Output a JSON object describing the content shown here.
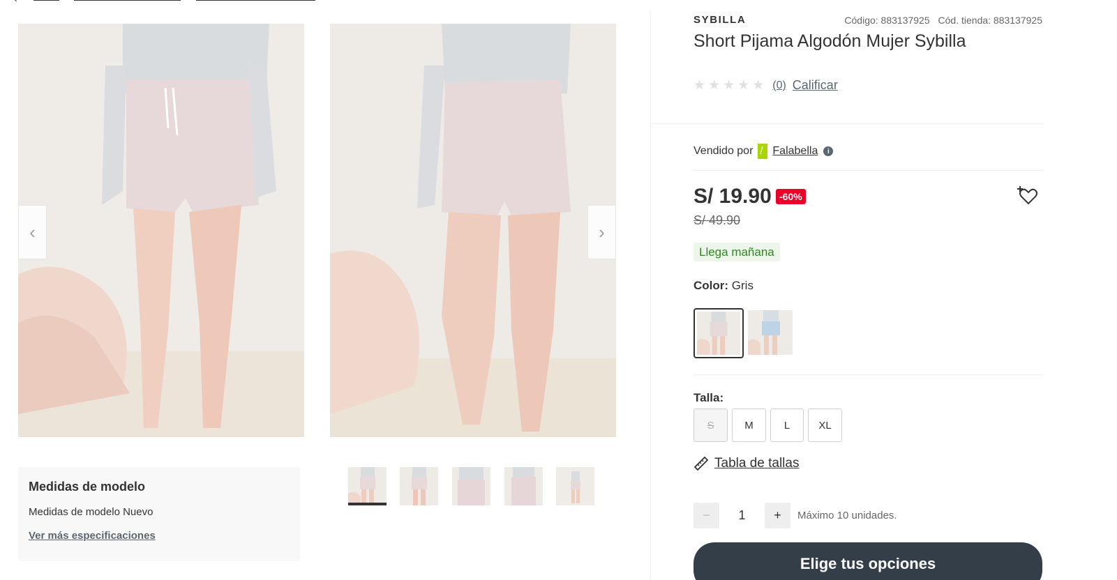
{
  "product": {
    "brand": "SYBILLA",
    "code_label": "Código: 883137925",
    "store_code_label": "Cód. tienda: 883137925",
    "title": "Short Pijama Algodón Mujer Sybilla",
    "rating_count": "(0)",
    "rate_label": "Calificar",
    "stars": 5,
    "rating_value": 0
  },
  "seller": {
    "prefix": "Vendido por",
    "name": "Falabella",
    "info_glyph": "i",
    "logo_color": "#aad500"
  },
  "pricing": {
    "price": "S/ 19.90",
    "discount": "-60%",
    "old_price": "S/ 49.90",
    "discount_color": "#eb0029"
  },
  "delivery": {
    "label": "Llega mañana",
    "color": "#30871f"
  },
  "color": {
    "label": "Color:",
    "value": "Gris",
    "options": [
      "gris",
      "celeste"
    ]
  },
  "size": {
    "label": "Talla:",
    "options": [
      "S",
      "M",
      "L",
      "XL"
    ],
    "disabled": [
      "S"
    ],
    "chart_label": "Tabla de tallas"
  },
  "quantity": {
    "minus": "−",
    "value": "1",
    "plus": "+",
    "limit_label": "Máximo 10 unidades."
  },
  "cta": {
    "label": "Elige tus opciones",
    "color": "#343e48"
  },
  "gallery": {
    "prev_glyph": "‹",
    "next_glyph": "›",
    "thumbnail_count": 5,
    "active_thumbnail": 1
  },
  "model_card": {
    "title": "Medidas de modelo",
    "text": "Medidas de modelo Nuevo",
    "link": "Ver más especificaciones"
  },
  "icons": {
    "prev": "chevron-left-icon",
    "next": "chevron-right-icon",
    "wishlist": "heart-plus-icon",
    "ruler": "ruler-icon",
    "info": "info-icon"
  }
}
